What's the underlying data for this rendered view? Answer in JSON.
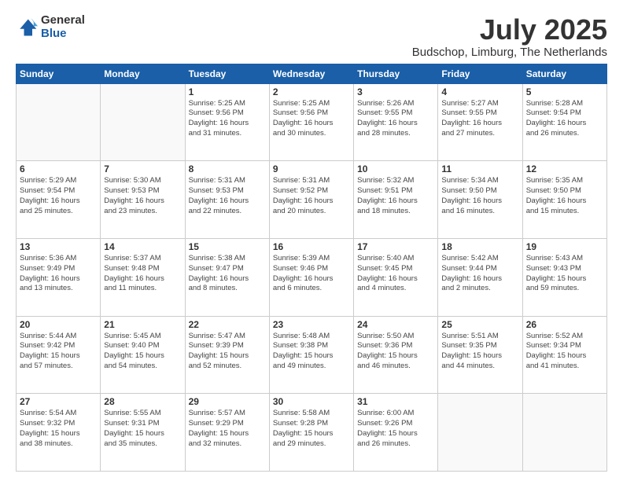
{
  "logo": {
    "general": "General",
    "blue": "Blue"
  },
  "title": "July 2025",
  "subtitle": "Budschop, Limburg, The Netherlands",
  "days_of_week": [
    "Sunday",
    "Monday",
    "Tuesday",
    "Wednesday",
    "Thursday",
    "Friday",
    "Saturday"
  ],
  "weeks": [
    [
      {
        "day": "",
        "info": ""
      },
      {
        "day": "",
        "info": ""
      },
      {
        "day": "1",
        "info": "Sunrise: 5:25 AM\nSunset: 9:56 PM\nDaylight: 16 hours\nand 31 minutes."
      },
      {
        "day": "2",
        "info": "Sunrise: 5:25 AM\nSunset: 9:56 PM\nDaylight: 16 hours\nand 30 minutes."
      },
      {
        "day": "3",
        "info": "Sunrise: 5:26 AM\nSunset: 9:55 PM\nDaylight: 16 hours\nand 28 minutes."
      },
      {
        "day": "4",
        "info": "Sunrise: 5:27 AM\nSunset: 9:55 PM\nDaylight: 16 hours\nand 27 minutes."
      },
      {
        "day": "5",
        "info": "Sunrise: 5:28 AM\nSunset: 9:54 PM\nDaylight: 16 hours\nand 26 minutes."
      }
    ],
    [
      {
        "day": "6",
        "info": "Sunrise: 5:29 AM\nSunset: 9:54 PM\nDaylight: 16 hours\nand 25 minutes."
      },
      {
        "day": "7",
        "info": "Sunrise: 5:30 AM\nSunset: 9:53 PM\nDaylight: 16 hours\nand 23 minutes."
      },
      {
        "day": "8",
        "info": "Sunrise: 5:31 AM\nSunset: 9:53 PM\nDaylight: 16 hours\nand 22 minutes."
      },
      {
        "day": "9",
        "info": "Sunrise: 5:31 AM\nSunset: 9:52 PM\nDaylight: 16 hours\nand 20 minutes."
      },
      {
        "day": "10",
        "info": "Sunrise: 5:32 AM\nSunset: 9:51 PM\nDaylight: 16 hours\nand 18 minutes."
      },
      {
        "day": "11",
        "info": "Sunrise: 5:34 AM\nSunset: 9:50 PM\nDaylight: 16 hours\nand 16 minutes."
      },
      {
        "day": "12",
        "info": "Sunrise: 5:35 AM\nSunset: 9:50 PM\nDaylight: 16 hours\nand 15 minutes."
      }
    ],
    [
      {
        "day": "13",
        "info": "Sunrise: 5:36 AM\nSunset: 9:49 PM\nDaylight: 16 hours\nand 13 minutes."
      },
      {
        "day": "14",
        "info": "Sunrise: 5:37 AM\nSunset: 9:48 PM\nDaylight: 16 hours\nand 11 minutes."
      },
      {
        "day": "15",
        "info": "Sunrise: 5:38 AM\nSunset: 9:47 PM\nDaylight: 16 hours\nand 8 minutes."
      },
      {
        "day": "16",
        "info": "Sunrise: 5:39 AM\nSunset: 9:46 PM\nDaylight: 16 hours\nand 6 minutes."
      },
      {
        "day": "17",
        "info": "Sunrise: 5:40 AM\nSunset: 9:45 PM\nDaylight: 16 hours\nand 4 minutes."
      },
      {
        "day": "18",
        "info": "Sunrise: 5:42 AM\nSunset: 9:44 PM\nDaylight: 16 hours\nand 2 minutes."
      },
      {
        "day": "19",
        "info": "Sunrise: 5:43 AM\nSunset: 9:43 PM\nDaylight: 15 hours\nand 59 minutes."
      }
    ],
    [
      {
        "day": "20",
        "info": "Sunrise: 5:44 AM\nSunset: 9:42 PM\nDaylight: 15 hours\nand 57 minutes."
      },
      {
        "day": "21",
        "info": "Sunrise: 5:45 AM\nSunset: 9:40 PM\nDaylight: 15 hours\nand 54 minutes."
      },
      {
        "day": "22",
        "info": "Sunrise: 5:47 AM\nSunset: 9:39 PM\nDaylight: 15 hours\nand 52 minutes."
      },
      {
        "day": "23",
        "info": "Sunrise: 5:48 AM\nSunset: 9:38 PM\nDaylight: 15 hours\nand 49 minutes."
      },
      {
        "day": "24",
        "info": "Sunrise: 5:50 AM\nSunset: 9:36 PM\nDaylight: 15 hours\nand 46 minutes."
      },
      {
        "day": "25",
        "info": "Sunrise: 5:51 AM\nSunset: 9:35 PM\nDaylight: 15 hours\nand 44 minutes."
      },
      {
        "day": "26",
        "info": "Sunrise: 5:52 AM\nSunset: 9:34 PM\nDaylight: 15 hours\nand 41 minutes."
      }
    ],
    [
      {
        "day": "27",
        "info": "Sunrise: 5:54 AM\nSunset: 9:32 PM\nDaylight: 15 hours\nand 38 minutes."
      },
      {
        "day": "28",
        "info": "Sunrise: 5:55 AM\nSunset: 9:31 PM\nDaylight: 15 hours\nand 35 minutes."
      },
      {
        "day": "29",
        "info": "Sunrise: 5:57 AM\nSunset: 9:29 PM\nDaylight: 15 hours\nand 32 minutes."
      },
      {
        "day": "30",
        "info": "Sunrise: 5:58 AM\nSunset: 9:28 PM\nDaylight: 15 hours\nand 29 minutes."
      },
      {
        "day": "31",
        "info": "Sunrise: 6:00 AM\nSunset: 9:26 PM\nDaylight: 15 hours\nand 26 minutes."
      },
      {
        "day": "",
        "info": ""
      },
      {
        "day": "",
        "info": ""
      }
    ]
  ]
}
